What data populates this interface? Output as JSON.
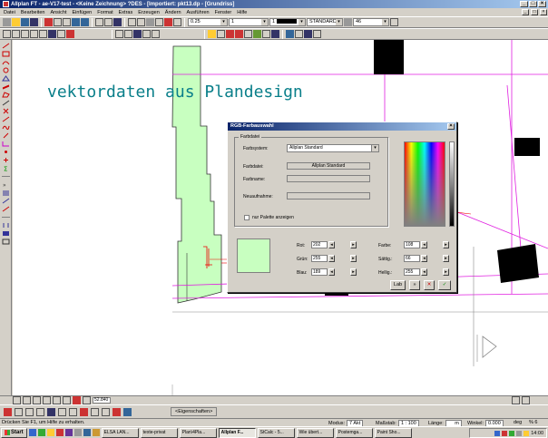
{
  "window": {
    "title": "Allplan FT - ae-V17-test - <Keine Zeichnung> ?DES - [Importiert: pkt13.dp - [Grundriss]",
    "minimize": "_",
    "maximize": "□",
    "close": "×"
  },
  "menu": {
    "items": [
      "Datei",
      "Bearbeiten",
      "Ansicht",
      "Einfügen",
      "Format",
      "Extras",
      "Erzeugen",
      "Ändern",
      "Ausführen",
      "Fenster",
      "Hilfe"
    ]
  },
  "toolbar": {
    "pen_value": "0.25",
    "line_value": "1",
    "color_value": "1",
    "layer_value": "STANDARD",
    "zoom_value": "46"
  },
  "canvas": {
    "annotation_text": "vektordaten aus Plandesign"
  },
  "dialog": {
    "title": "RGB-Farbauswahl",
    "close": "×",
    "group_label": "Farbdatei",
    "farbsystem_label": "Farbsystem:",
    "farbsystem_value": "Allplan Standard",
    "farbdatei_label": "Farbdatei:",
    "farbdatei_value": "Allplan Standard",
    "farbname_label": "Farbname:",
    "neuaufnahme_label": "Neuaufnahme:",
    "palette_checkbox_label": "nur Palette anzeigen",
    "rot_label": "Rot:",
    "rot_value": "202",
    "gruen_label": "Grün:",
    "gruen_value": "255",
    "blau_label": "Blau:",
    "blau_value": "189",
    "farbe_label": "Farbe:",
    "farbe_value": "108",
    "saett_label": "Sättig.:",
    "saett_value": "66",
    "hell_label": "Hellig.:",
    "hell_value": "255",
    "arrow_left": "◂",
    "arrow_right": "▸",
    "btn_lab": "Lab",
    "btn_more": "»",
    "btn_cancel": "✕",
    "btn_ok": "✓",
    "preview_color": "#c8ffc0"
  },
  "viewbar": {
    "zoom_field": "52.840"
  },
  "propbar": {
    "eigenschaften": "<Eigenschaften>"
  },
  "status": {
    "help_text": "Drücken Sie F1, um Hilfe zu erhalten.",
    "modus_label": "Modus:",
    "modus_value": "7 Akt",
    "massstab_label": "Maßstab:",
    "massstab_value": "1 : 100",
    "laenge_label": "Länge:",
    "laenge_value": "m",
    "winkel_label": "Winkel:",
    "winkel_value": "0.000",
    "deg_label": "deg",
    "pct": "% 6"
  },
  "taskbar": {
    "start": "Start",
    "tasks": [
      "ELSA LAN...",
      "texte-privat",
      "Plan\\4Pla...",
      "Allplan F...",
      "StCalc - 5...",
      "Wie übert...",
      "Postemga...",
      "Paint Sho..."
    ],
    "clock": "14:00"
  },
  "colors": {
    "accent_teal": "#0a7f8a",
    "wall_fill": "#c8ffc0",
    "magenta_line": "#e01ee0",
    "titlebar": "#0a246a"
  }
}
